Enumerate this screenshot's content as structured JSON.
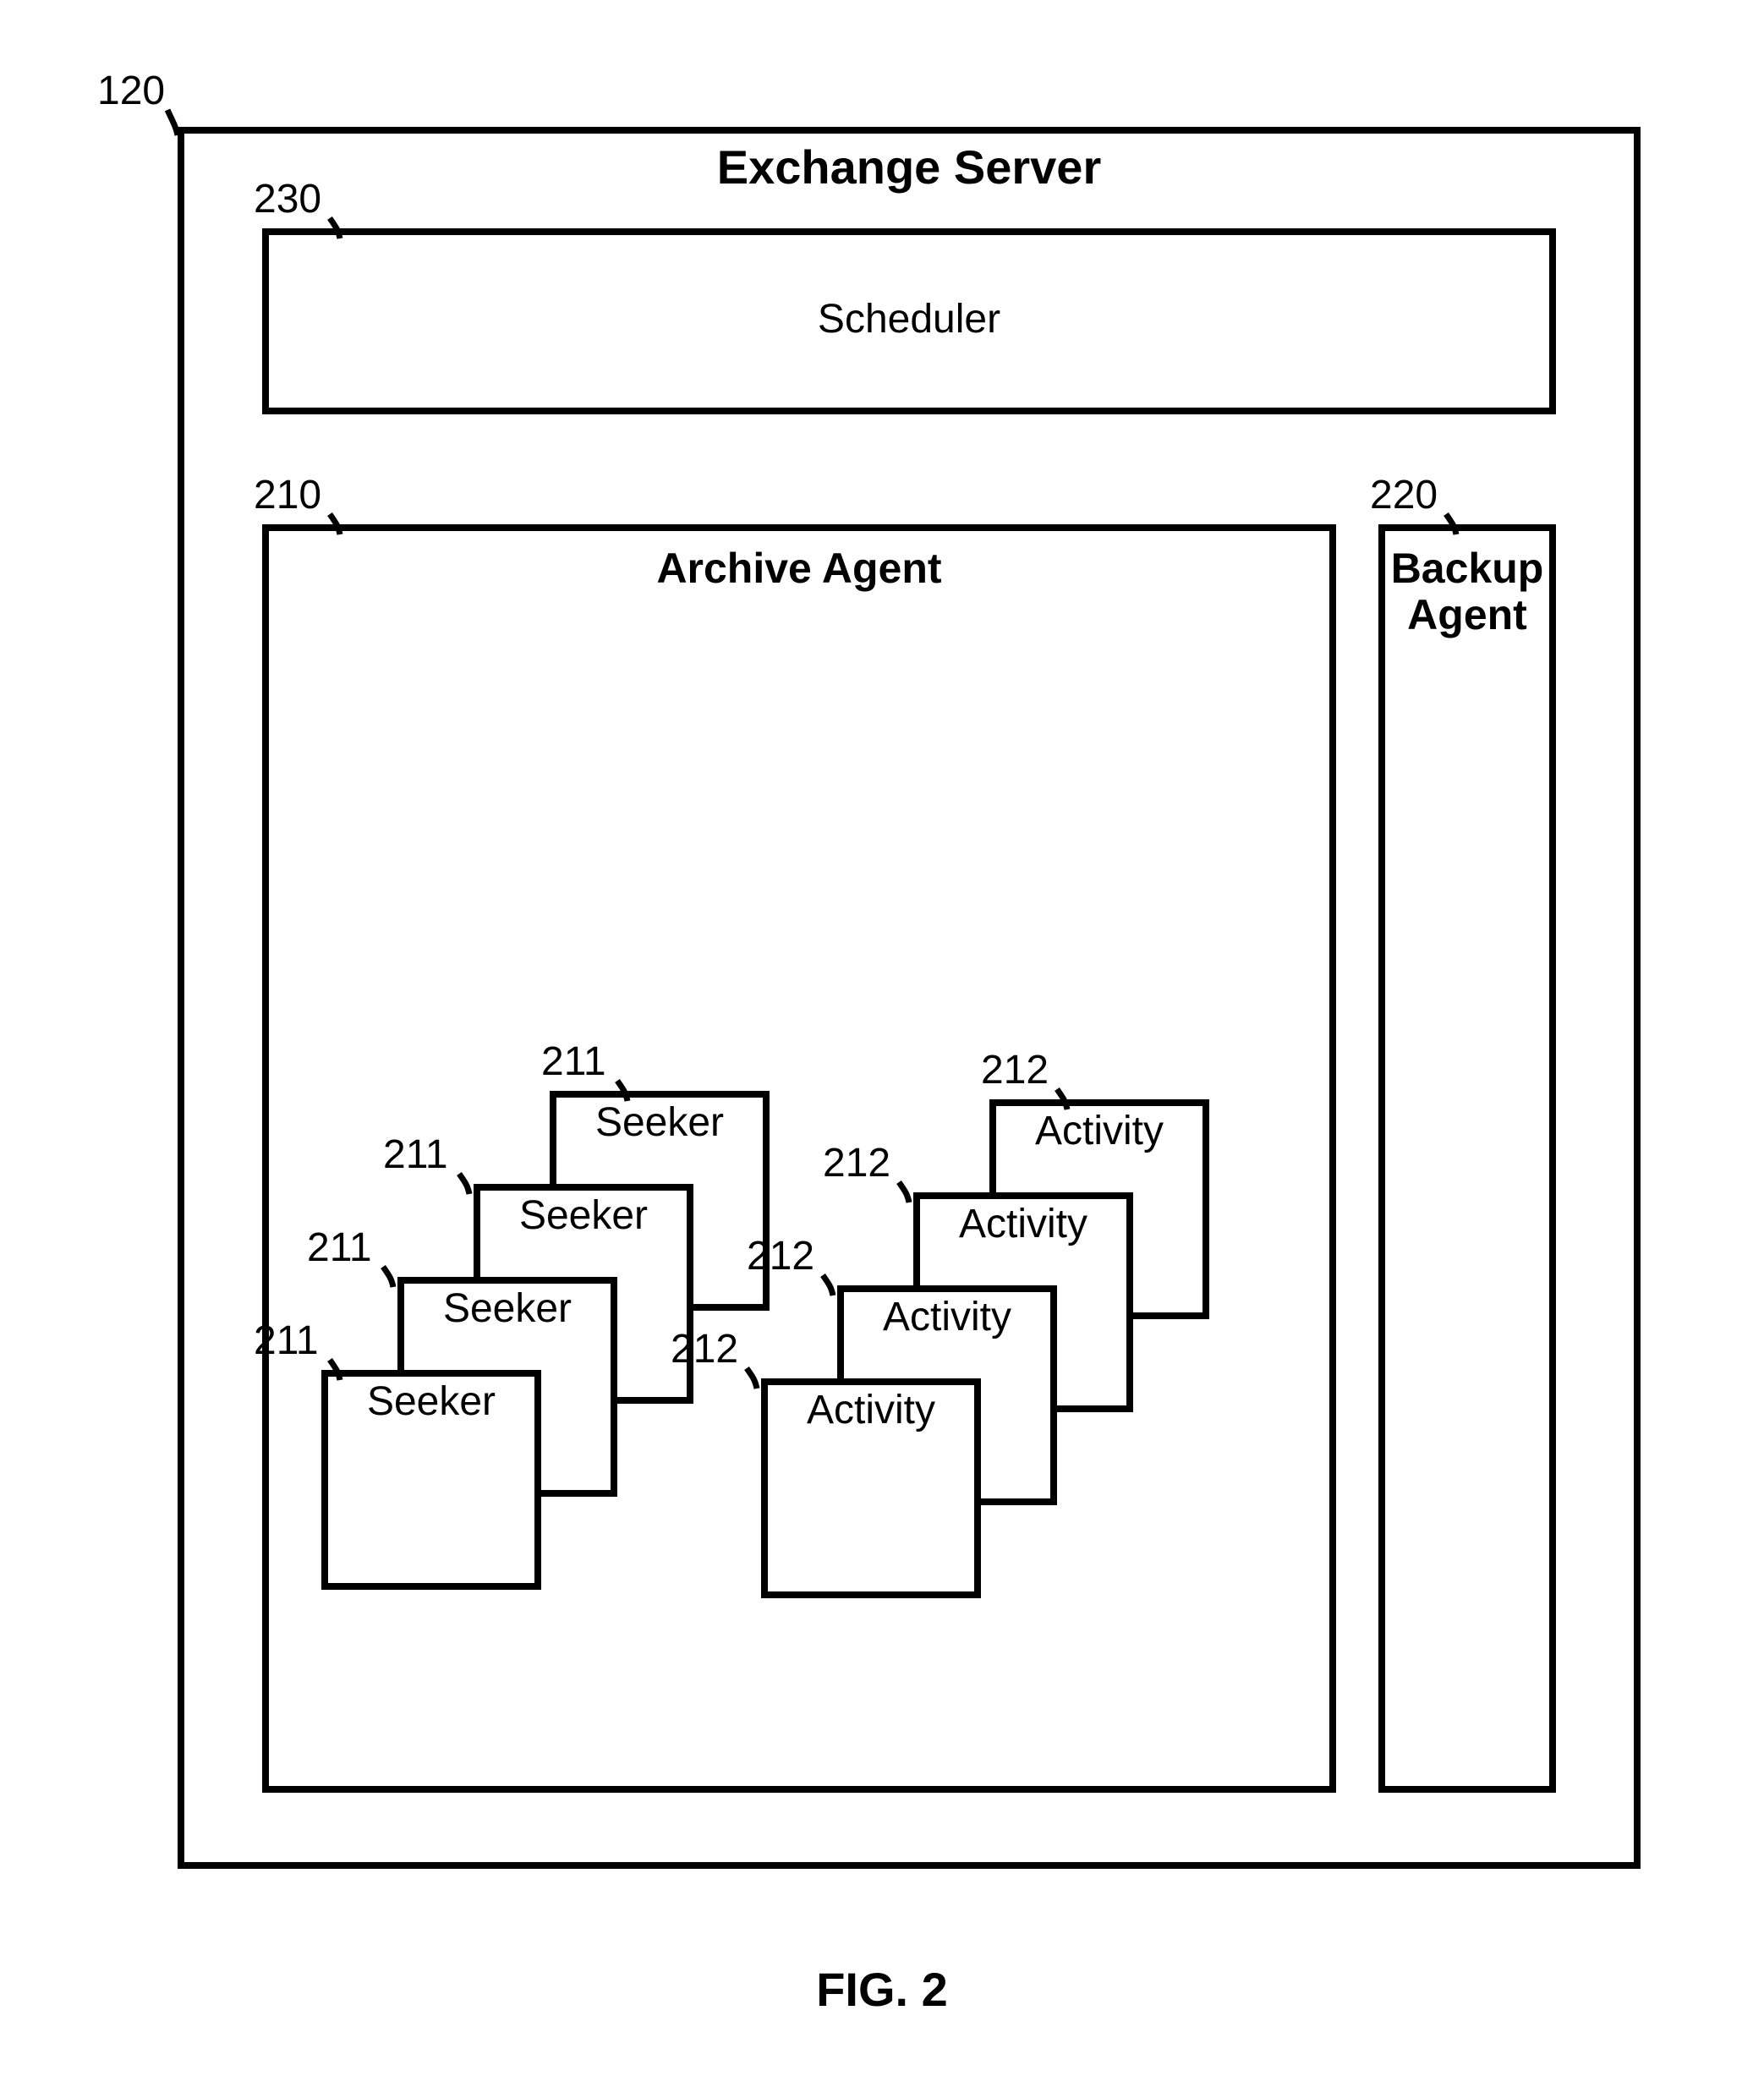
{
  "refs": {
    "outer": "120",
    "scheduler": "230",
    "archive": "210",
    "backup": "220",
    "seeker": "211",
    "activity": "212"
  },
  "titles": {
    "main": "Exchange Server",
    "scheduler": "Scheduler",
    "archive": "Archive Agent",
    "backup": "Backup\nAgent"
  },
  "labels": {
    "seeker": "Seeker",
    "activity": "Activity"
  },
  "figure": "FIG. 2"
}
